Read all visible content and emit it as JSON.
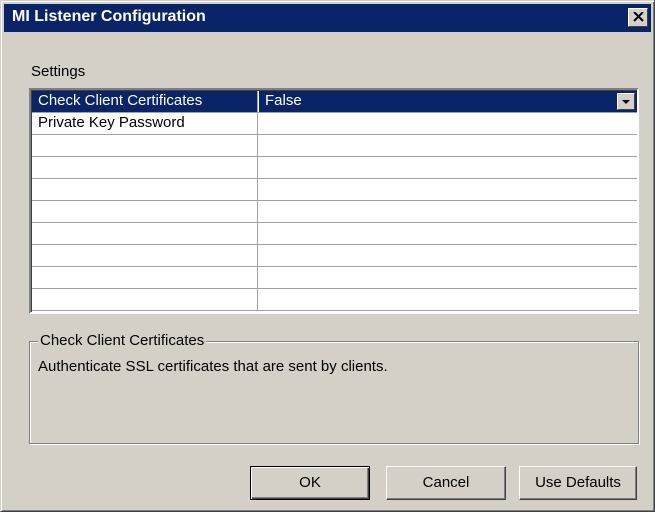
{
  "window": {
    "title": "MI Listener Configuration"
  },
  "settings": {
    "label": "Settings",
    "rows": [
      {
        "name": "Check Client Certificates",
        "value": "False",
        "selected": true
      },
      {
        "name": "Private Key Password",
        "value": ""
      },
      {
        "name": "",
        "value": ""
      },
      {
        "name": "",
        "value": ""
      },
      {
        "name": "",
        "value": ""
      },
      {
        "name": "",
        "value": ""
      },
      {
        "name": "",
        "value": ""
      },
      {
        "name": "",
        "value": ""
      },
      {
        "name": "",
        "value": ""
      },
      {
        "name": "",
        "value": ""
      }
    ]
  },
  "description": {
    "title": "Check Client Certificates",
    "text": "Authenticate SSL certificates that are sent by clients."
  },
  "buttons": {
    "ok": "OK",
    "cancel": "Cancel",
    "use_defaults": "Use Defaults"
  },
  "colors": {
    "titlebar": "#0a246a",
    "face": "#d4d0c8",
    "selection": "#0a246a"
  },
  "icons": {
    "close": "close-icon",
    "dropdown": "chevron-down-icon"
  }
}
